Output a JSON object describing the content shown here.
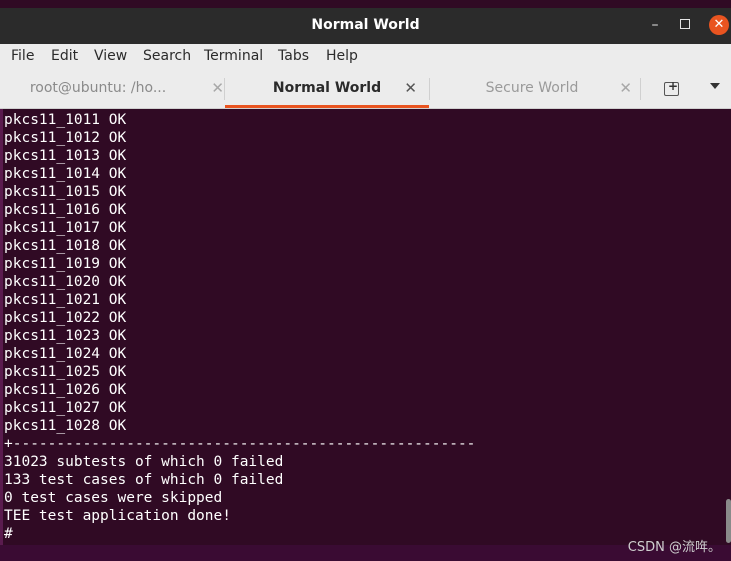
{
  "window": {
    "title": "Normal World",
    "minimize_glyph": "–",
    "close_glyph": "✕"
  },
  "menu": [
    "File",
    "Edit",
    "View",
    "Search",
    "Terminal",
    "Tabs",
    "Help"
  ],
  "tabs": [
    {
      "label": "root@ubuntu: /ho...",
      "active": false
    },
    {
      "label": "Normal World",
      "active": true
    },
    {
      "label": "Secure World",
      "active": false
    }
  ],
  "tab_close_glyph": "✕",
  "terminal_lines": [
    "pkcs11_1011 OK",
    "pkcs11_1012 OK",
    "pkcs11_1013 OK",
    "pkcs11_1014 OK",
    "pkcs11_1015 OK",
    "pkcs11_1016 OK",
    "pkcs11_1017 OK",
    "pkcs11_1018 OK",
    "pkcs11_1019 OK",
    "pkcs11_1020 OK",
    "pkcs11_1021 OK",
    "pkcs11_1022 OK",
    "pkcs11_1023 OK",
    "pkcs11_1024 OK",
    "pkcs11_1025 OK",
    "pkcs11_1026 OK",
    "pkcs11_1027 OK",
    "pkcs11_1028 OK",
    "+-----------------------------------------------------",
    "31023 subtests of which 0 failed",
    "133 test cases of which 0 failed",
    "0 test cases were skipped",
    "TEE test application done!",
    "#"
  ],
  "watermark": "CSDN @流哖。",
  "colors": {
    "terminal_bg": "#300a24",
    "accent": "#e95420",
    "terminal_fg": "#ffffff"
  }
}
